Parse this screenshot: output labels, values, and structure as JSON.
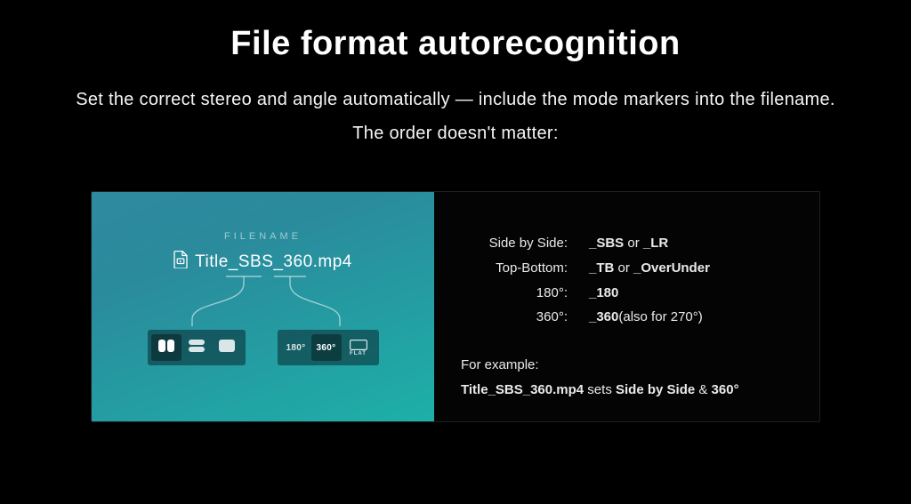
{
  "header": {
    "title": "File format autorecognition",
    "subtitle_line1": "Set the correct stereo and angle automatically — include the mode markers into the filename.",
    "subtitle_line2": "The order doesn't matter:"
  },
  "left_panel": {
    "label": "FILENAME",
    "filename": "Title_SBS_360.mp4",
    "stereo_chips": {
      "sbs": "sbs",
      "tb": "tb",
      "mono": "mono",
      "selected": "sbs"
    },
    "angle_chips": {
      "a180": "180°",
      "a360": "360°",
      "flat": "FLAT",
      "selected": "a360"
    }
  },
  "right_panel": {
    "rows": [
      {
        "key": "Side by Side:",
        "markers": [
          "_SBS",
          "_LR"
        ],
        "join": " or "
      },
      {
        "key": "Top-Bottom:",
        "markers": [
          "_TB",
          "_OverUnder"
        ],
        "join": " or "
      },
      {
        "key": "180°:",
        "markers": [
          "_180"
        ],
        "join": ""
      },
      {
        "key": "360°:",
        "markers": [
          "_360"
        ],
        "join": "",
        "suffix": "(also for 270°)"
      }
    ],
    "example_label": "For example:",
    "example_filename": "Title_SBS_360.mp4",
    "example_mid": " sets ",
    "example_mode1": "Side by Side",
    "example_amp": " & ",
    "example_mode2": "360°"
  }
}
